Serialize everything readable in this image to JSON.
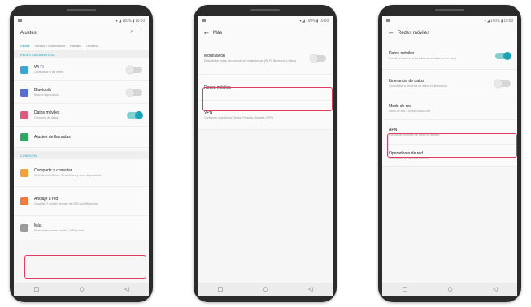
{
  "colors": {
    "accent": "#1aa3b8",
    "highlight": "#e33a5f",
    "toggle_on": "#1aa3b8"
  },
  "icons": {
    "back": "arrow-left-icon",
    "search": "search-icon",
    "more": "more-vert-icon"
  },
  "screen1": {
    "title": "Ajustes",
    "tabs": [
      "Redes",
      "Sonido y Notificación",
      "Pantalla",
      "General"
    ],
    "section1": "REDES INALÁMBRICAS",
    "items": [
      {
        "label": "Wi-Fi",
        "sub": "Conectarse a las redes",
        "icon": "wifi-icon",
        "icon_color": "#3aa5d8",
        "toggle": "off"
      },
      {
        "label": "Bluetooth",
        "sub": "Buscar dispositivos",
        "icon": "bluetooth-icon",
        "icon_color": "#5a6fd6",
        "toggle": "off"
      },
      {
        "label": "Datos móviles",
        "sub": "Consumo de datos",
        "icon": "mobile-data-icon",
        "icon_color": "#e35a7d",
        "toggle": "on"
      },
      {
        "label": "Ajustes de llamadas",
        "sub": "",
        "icon": "phone-icon",
        "icon_color": "#2fa866",
        "toggle": ""
      }
    ],
    "section2": "CONEXIÓN",
    "items2": [
      {
        "label": "Compartir y conectar",
        "sub": "NFC, Android Beam, SmartShare y otros dispositivos",
        "icon": "share-icon",
        "icon_color": "#f0a23a"
      },
      {
        "label": "Anclaje a red",
        "sub": "Zona Wi-Fi portátil, anclaje de USB y de Bluetooth",
        "icon": "hotspot-icon",
        "icon_color": "#f07a3a"
      },
      {
        "label": "Más",
        "sub": "Modo avión, redes móviles, VPN y más",
        "icon": "more-icon",
        "icon_color": "#9b9b9b"
      }
    ]
  },
  "screen2": {
    "title": "Más",
    "items": [
      {
        "label": "Modo avión",
        "sub": "Deshabilitar todas las conexiones inalámbricas (Wi-Fi, Bluetooth y datos)",
        "toggle": "off"
      },
      {
        "label": "Redes móviles",
        "sub": "",
        "toggle": ""
      },
      {
        "label": "VPN",
        "sub": "Configurar y gestionar Redes Privadas Virtuales (VPN)",
        "toggle": ""
      }
    ]
  },
  "screen3": {
    "title": "Redes móviles",
    "items": [
      {
        "label": "Datos móviles",
        "sub": "Permitir el acceso a los datos a través de la red móvil",
        "toggle": "on"
      },
      {
        "label": "Itinerancia de datos",
        "sub": "Conectarse a servicios de datos en itinerancia",
        "toggle": "off"
      },
      {
        "label": "Modo de red",
        "sub": "Modo de red: LTE/WCDMA/GSM",
        "toggle": ""
      },
      {
        "label": "APN",
        "sub": "Configurar nombres de punto de acceso",
        "toggle": ""
      },
      {
        "label": "Operadores de red",
        "sub": "Seleccionar un operador de red",
        "toggle": ""
      }
    ]
  },
  "statusbar": {
    "right": "▾ ◢ 100% ▮ 10:00"
  },
  "navbar": {
    "recent": "□",
    "home": "○",
    "back": "◁"
  }
}
